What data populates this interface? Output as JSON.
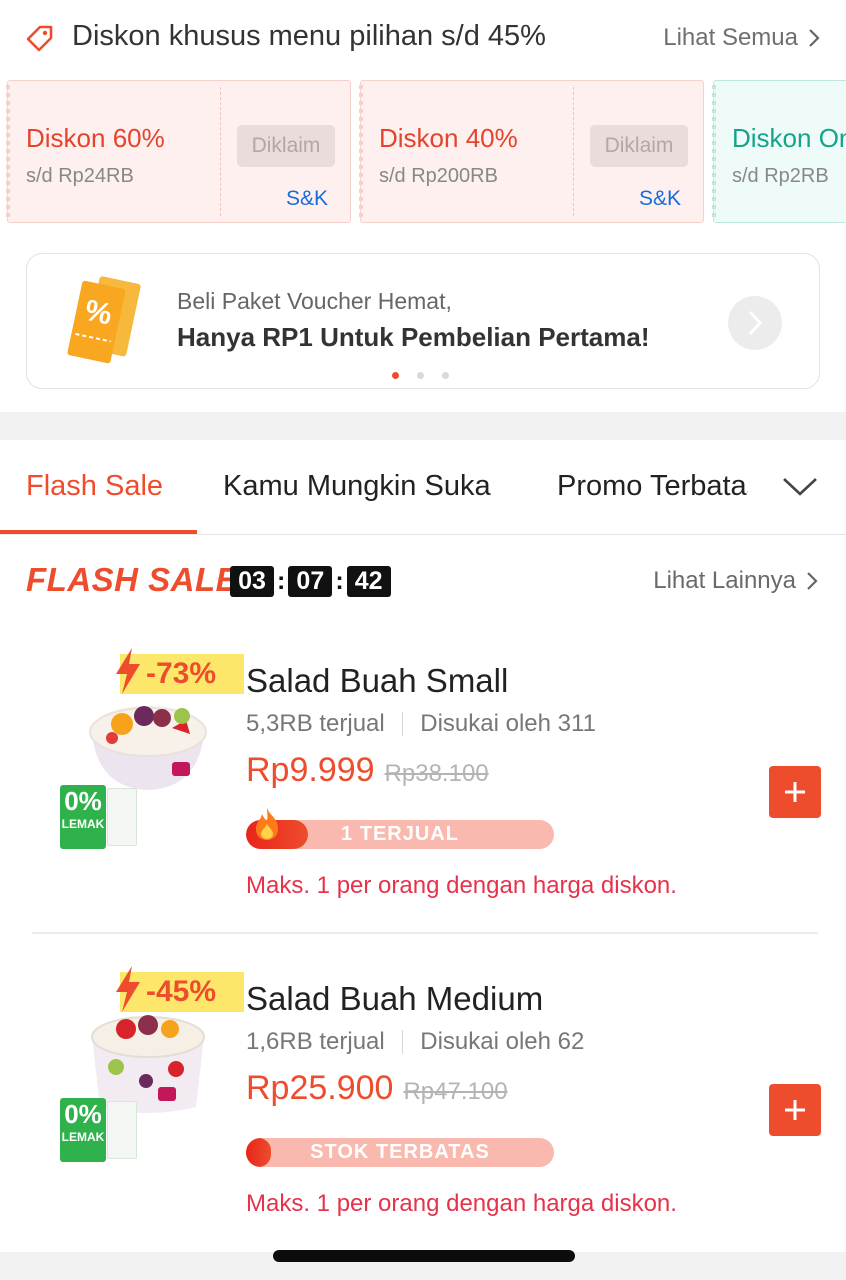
{
  "discount_header": {
    "title": "Diskon khusus menu pilihan s/d 45%",
    "see_all": "Lihat Semua",
    "icon": "tag-icon"
  },
  "vouchers": [
    {
      "title": "Diskon 60%",
      "subtitle": "s/d Rp24RB",
      "claim_label": "Diklaim",
      "terms": "S&K"
    },
    {
      "title": "Diskon 40%",
      "subtitle": "s/d Rp200RB",
      "claim_label": "Diklaim",
      "terms": "S&K"
    },
    {
      "title": "Diskon Ong",
      "subtitle": "s/d Rp2RB"
    }
  ],
  "promo_banner": {
    "line1": "Beli Paket Voucher Hemat,",
    "line2": "Hanya RP1 Untuk Pembelian Pertama!",
    "active_dot": 1,
    "dot_count": 3,
    "icon": "voucher-ticket-icon"
  },
  "tabs": [
    {
      "label": "Flash Sale",
      "active": true
    },
    {
      "label": "Kamu Mungkin Suka",
      "active": false
    },
    {
      "label": "Promo Terbatas",
      "active": false
    }
  ],
  "flash_sale": {
    "logo_text": "FLASH SALE",
    "timer": {
      "hours": "03",
      "minutes": "07",
      "seconds": "42"
    },
    "see_more": "Lihat Lainnya"
  },
  "products": [
    {
      "discount": "-73%",
      "name": "Salad Buah Small",
      "sold": "5,3RB terjual",
      "liked": "Disukai oleh 311",
      "price": "Rp9.999",
      "old_price": "Rp38.100",
      "stock_label": "1 TERJUAL",
      "stock_fill_percent": 20,
      "limit_text": "Maks. 1 per orang dengan harga diskon.",
      "badge_text": "0%",
      "badge_label": "LEMAK"
    },
    {
      "discount": "-45%",
      "name": "Salad Buah Medium",
      "sold": "1,6RB terjual",
      "liked": "Disukai oleh 62",
      "price": "Rp25.900",
      "old_price": "Rp47.100",
      "stock_label": "STOK TERBATAS",
      "stock_fill_percent": 8,
      "limit_text": "Maks. 1 per orang dengan harga diskon.",
      "badge_text": "0%",
      "badge_label": "LEMAK"
    }
  ],
  "colors": {
    "accent": "#ee4d2d",
    "link_blue": "#1a6cdb",
    "teal": "#13a489",
    "limit_red": "#e6324b",
    "badge_yellow": "#fde76b"
  }
}
